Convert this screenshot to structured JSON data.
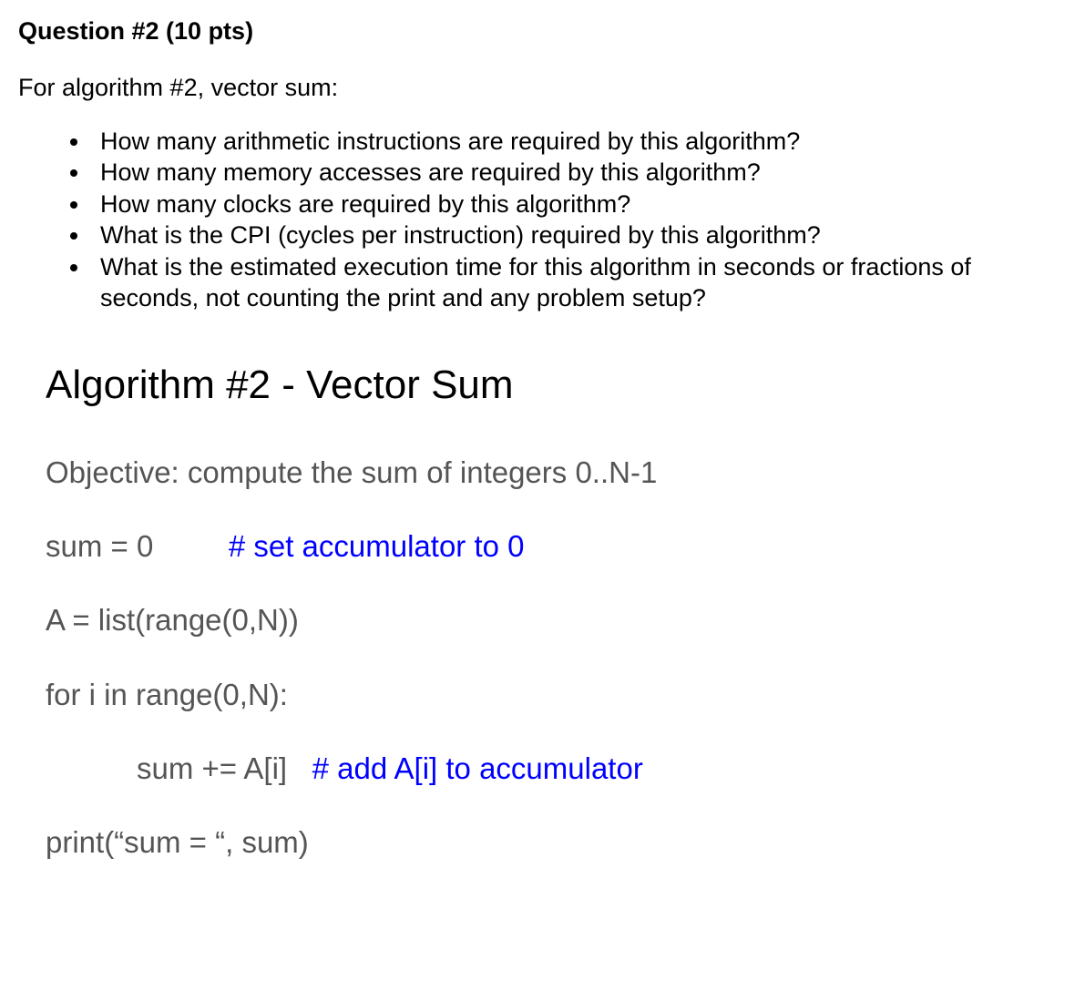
{
  "question": {
    "header": "Question #2 (10 pts)",
    "intro": "For algorithm #2, vector sum:",
    "bullets": [
      "How many arithmetic instructions are required by this algorithm?",
      "How many memory accesses are required by this algorithm?",
      "How many clocks are required by this algorithm?",
      "What is the CPI (cycles per instruction) required by this algorithm?",
      "What is the estimated execution time for this algorithm in seconds or fractions of seconds, not counting the print and any problem setup?"
    ]
  },
  "algorithm": {
    "title": "Algorithm #2 - Vector Sum",
    "objective": "Objective: compute the sum of integers 0..N-1",
    "lines": {
      "l1_code": "sum = 0",
      "l1_spacer": "         ",
      "l1_comment": "# set accumulator to 0",
      "l2_code": "A = list(range(0,N))",
      "l3_code": "for i in range(0,N):",
      "l4_code": "sum += A[i]",
      "l4_spacer": "   ",
      "l4_comment": "# add A[i] to accumulator",
      "l5_code": "print(“sum = “, sum)"
    }
  }
}
